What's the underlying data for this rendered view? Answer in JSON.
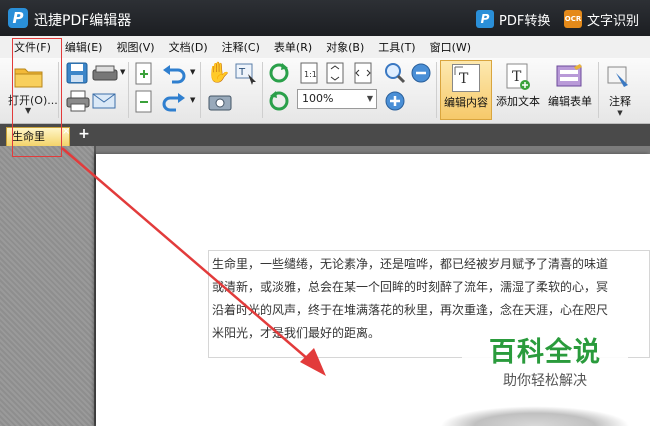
{
  "titlebar": {
    "app_title": "迅捷PDF编辑器",
    "pdf_convert": "PDF转换",
    "ocr_label": "文字识别",
    "ocr_badge": "OCR"
  },
  "menu": [
    "文件(F)",
    "编辑(E)",
    "视图(V)",
    "文档(D)",
    "注释(C)",
    "表单(R)",
    "对象(B)",
    "工具(T)",
    "窗口(W)"
  ],
  "toolbar": {
    "open_label": "打开(O)...",
    "zoom_value": "100%",
    "edit_content_label": "编辑内容",
    "add_text_label": "添加文本",
    "edit_form_label": "编辑表单",
    "annotate_label": "注释"
  },
  "tabs": {
    "doc_tab_label": "生命里",
    "close_glyph": "×",
    "add_glyph": "+"
  },
  "document": {
    "lines": [
      "生命里，一些缱绻，无论素净，还是喧哗，都已经被岁月赋予了清喜的味道",
      "或清新，或淡雅，总会在某一个回眸的时刻醉了流年，濡湿了柔软的心，冥",
      "沿着时光的风声，终于在堆满落花的秋里，再次重逢，念在天涯，心在咫尺",
      "米阳光，才是我们最好的距离。"
    ]
  },
  "watermark": {
    "main": "百科全说",
    "sub": "助你轻松解决"
  },
  "colors": {
    "accent_blue": "#2a8fd8",
    "annotation_red": "#e23b3b",
    "watermark_green": "#2a9b3c"
  }
}
